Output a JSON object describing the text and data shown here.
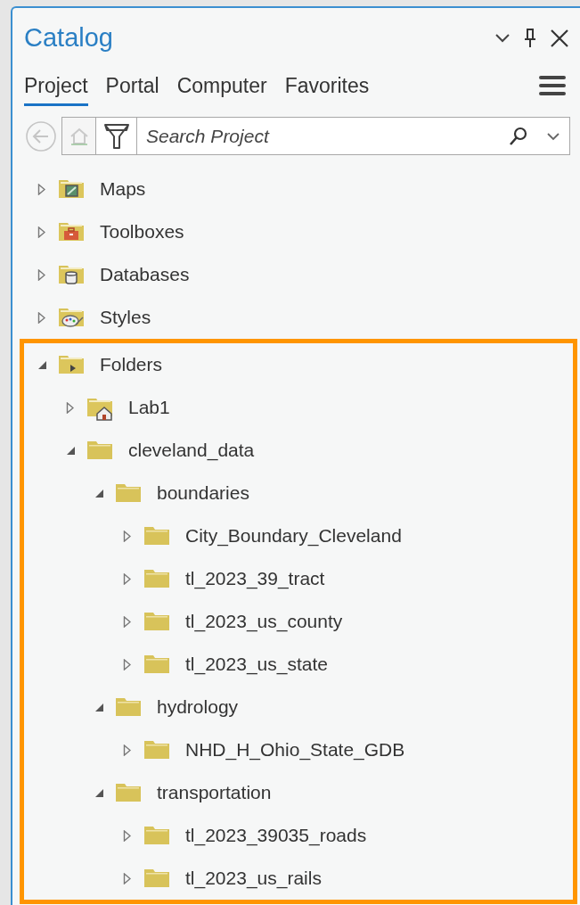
{
  "panel": {
    "title": "Catalog"
  },
  "tabs": [
    {
      "label": "Project",
      "selected": true
    },
    {
      "label": "Portal",
      "selected": false
    },
    {
      "label": "Computer",
      "selected": false
    },
    {
      "label": "Favorites",
      "selected": false
    }
  ],
  "search": {
    "placeholder": "Search Project"
  },
  "tree": [
    {
      "label": "Maps",
      "kind": "maps",
      "expanded": false
    },
    {
      "label": "Toolboxes",
      "kind": "toolboxes",
      "expanded": false
    },
    {
      "label": "Databases",
      "kind": "databases",
      "expanded": false
    },
    {
      "label": "Styles",
      "kind": "styles",
      "expanded": false
    },
    {
      "label": "Folders",
      "kind": "folders",
      "expanded": true,
      "highlighted": true,
      "children": [
        {
          "label": "Lab1",
          "kind": "home-folder",
          "expanded": false
        },
        {
          "label": "cleveland_data",
          "kind": "folder",
          "expanded": true,
          "children": [
            {
              "label": "boundaries",
              "kind": "folder",
              "expanded": true,
              "children": [
                {
                  "label": "City_Boundary_Cleveland",
                  "kind": "folder",
                  "expanded": false
                },
                {
                  "label": "tl_2023_39_tract",
                  "kind": "folder",
                  "expanded": false
                },
                {
                  "label": "tl_2023_us_county",
                  "kind": "folder",
                  "expanded": false
                },
                {
                  "label": "tl_2023_us_state",
                  "kind": "folder",
                  "expanded": false
                }
              ]
            },
            {
              "label": "hydrology",
              "kind": "folder",
              "expanded": true,
              "children": [
                {
                  "label": "NHD_H_Ohio_State_GDB",
                  "kind": "folder",
                  "expanded": false
                }
              ]
            },
            {
              "label": "transportation",
              "kind": "folder",
              "expanded": true,
              "children": [
                {
                  "label": "tl_2023_39035_roads",
                  "kind": "folder",
                  "expanded": false
                },
                {
                  "label": "tl_2023_us_rails",
                  "kind": "folder",
                  "expanded": false
                }
              ]
            }
          ]
        }
      ]
    }
  ]
}
